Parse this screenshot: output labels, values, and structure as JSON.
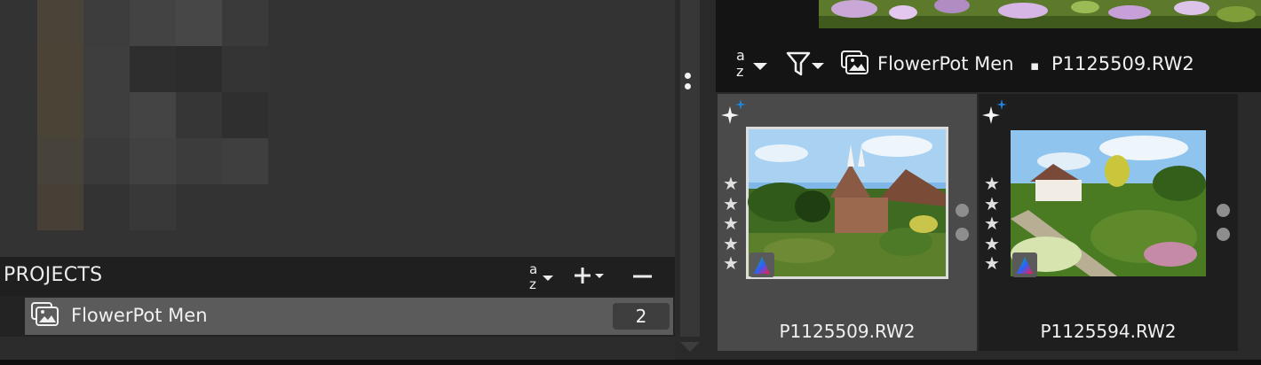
{
  "projects_panel": {
    "title": "PROJECTS",
    "sort_icon": "sort-az-icon",
    "add_icon": "add-icon",
    "remove_icon": "remove-icon",
    "items": [
      {
        "name": "FlowerPot Men",
        "count": "2",
        "icon": "collection-icon"
      }
    ]
  },
  "browser_toolbar": {
    "sort_icon": "sort-az-icon",
    "filter_icon": "filter-icon",
    "collection_icon": "collection-icon",
    "collection_name": "FlowerPot Men",
    "separator": "▪",
    "selected_file": "P1125509.RW2"
  },
  "thumbnails": [
    {
      "filename": "P1125509.RW2",
      "rating_stars": 5,
      "selected": true,
      "auto_enhance_icon": "sparkle-icon",
      "color_profile_icon": "color-profile-icon"
    },
    {
      "filename": "P1125594.RW2",
      "rating_stars": 5,
      "selected": false,
      "auto_enhance_icon": "sparkle-icon",
      "color_profile_icon": "color-profile-icon"
    }
  ],
  "colors": {
    "background": "#2b2b2b",
    "header": "#1f1f1f",
    "selected_row": "#5b5b5b",
    "selected_cell": "#4a4a4a",
    "sparkle_blue": "#1e88e5"
  }
}
